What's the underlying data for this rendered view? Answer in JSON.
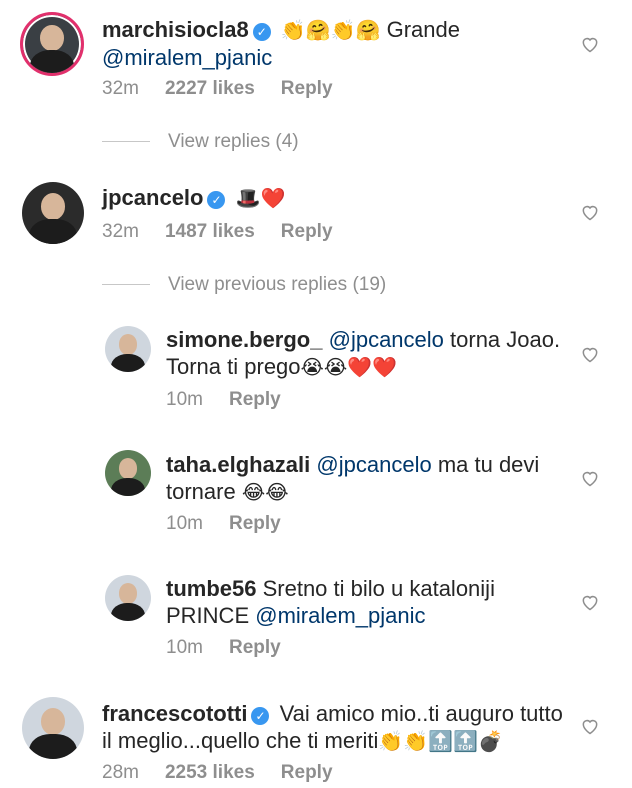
{
  "comments": [
    {
      "username": "marchisiocla8",
      "verified": true,
      "text_parts": [
        {
          "type": "emoji",
          "value": "👏🤗👏🤗"
        },
        {
          "type": "text",
          "value": " Grande "
        },
        {
          "type": "mention",
          "value": "@miralem_pjanic"
        }
      ],
      "time": "32m",
      "likes": "2227 likes",
      "reply": "Reply",
      "view_replies": "View replies (4)"
    },
    {
      "username": "jpcancelo",
      "verified": true,
      "text_parts": [
        {
          "type": "emoji",
          "value": "🎩❤️"
        }
      ],
      "time": "32m",
      "likes": "1487 likes",
      "reply": "Reply",
      "view_replies": "View previous replies (19)",
      "replies": [
        {
          "username": "simone.bergo_",
          "line1_mention": "@jpcancelo",
          "line1_text": " torna Joao.",
          "line2_text": "Torna ti prego",
          "line2_emoji": "😭😭❤️❤️",
          "time": "10m",
          "reply": "Reply"
        },
        {
          "username": "taha.elghazali",
          "line1_mention": "@jpcancelo",
          "line1_text": " ma tu devi",
          "line2_text": "tornare ",
          "line2_emoji": "😂😂",
          "time": "10m",
          "reply": "Reply"
        },
        {
          "username": "tumbe56",
          "line1_text": " Sretno ti bilo u kataloniji",
          "line2_text": "PRINCE ",
          "line2_mention": "@miralem_pjanic",
          "time": "10m",
          "reply": "Reply"
        }
      ]
    },
    {
      "username": "francescototti",
      "verified": true,
      "line1_text": " Vai amico mio..ti auguro tutto",
      "line2_text": "il meglio...quello che ti meriti",
      "line2_emoji": "👏👏🔝🔝💣",
      "time": "28m",
      "likes": "2253 likes",
      "reply": "Reply"
    }
  ],
  "icons": {
    "like": "heart-icon",
    "verified": "verified-badge-icon"
  },
  "colors": {
    "mention": "#00376b",
    "meta": "#8e8e8e",
    "verified": "#3897f0",
    "story_ring": "#e1306c"
  }
}
